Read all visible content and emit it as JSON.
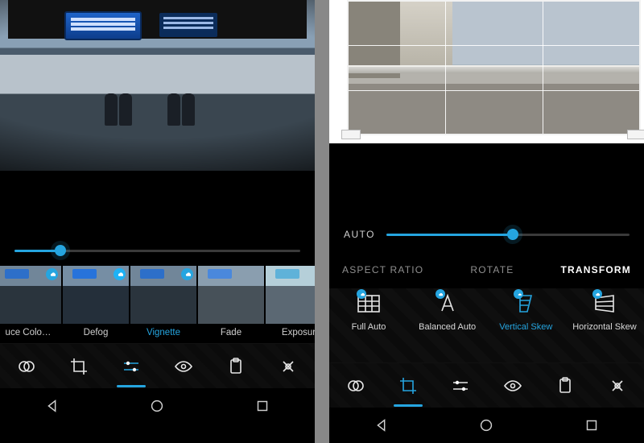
{
  "accent": "#25a5e0",
  "left": {
    "slider": {
      "value": 16,
      "min": 0,
      "max": 100
    },
    "filters": [
      {
        "id": "reduce-color-noise",
        "label": "uce Colo…",
        "cloud": true
      },
      {
        "id": "defog",
        "label": "Defog",
        "cloud": true
      },
      {
        "id": "vignette",
        "label": "Vignette",
        "cloud": true,
        "selected": true
      },
      {
        "id": "fade",
        "label": "Fade"
      },
      {
        "id": "exposure",
        "label": "Exposur"
      }
    ],
    "toolbar": [
      {
        "id": "filters",
        "icon": "overlap-circles"
      },
      {
        "id": "crop",
        "icon": "crop"
      },
      {
        "id": "adjust",
        "icon": "sliders",
        "active": true
      },
      {
        "id": "redeye",
        "icon": "eye"
      },
      {
        "id": "clipboard",
        "icon": "clipboard"
      },
      {
        "id": "heal",
        "icon": "sparkle"
      }
    ],
    "nav": [
      {
        "id": "back",
        "icon": "triangle-left"
      },
      {
        "id": "home",
        "icon": "circle"
      },
      {
        "id": "recent",
        "icon": "square"
      }
    ]
  },
  "right": {
    "autoLabel": "AUTO",
    "autoSlider": {
      "value": 52,
      "min": 0,
      "max": 100
    },
    "tabs": [
      {
        "id": "aspect-ratio",
        "label": "ASPECT RATIO"
      },
      {
        "id": "rotate",
        "label": "ROTATE"
      },
      {
        "id": "transform",
        "label": "TRANSFORM",
        "active": true
      }
    ],
    "presets": [
      {
        "id": "full-auto",
        "label": "Full Auto",
        "icon": "grid",
        "cloud": true
      },
      {
        "id": "balanced-auto",
        "label": "Balanced Auto",
        "icon": "text-skew",
        "cloud": true
      },
      {
        "id": "vertical-skew",
        "label": "Vertical Skew",
        "icon": "trapezoid-v",
        "cloud": true,
        "active": true
      },
      {
        "id": "horizontal-skew",
        "label": "Horizontal Skew",
        "icon": "trapezoid-h",
        "cloud": true
      }
    ],
    "toolbar": [
      {
        "id": "filters",
        "icon": "overlap-circles"
      },
      {
        "id": "crop",
        "icon": "crop",
        "active": true
      },
      {
        "id": "adjust",
        "icon": "sliders"
      },
      {
        "id": "redeye",
        "icon": "eye"
      },
      {
        "id": "clipboard",
        "icon": "clipboard"
      },
      {
        "id": "heal",
        "icon": "sparkle"
      }
    ],
    "nav": [
      {
        "id": "back",
        "icon": "triangle-left"
      },
      {
        "id": "home",
        "icon": "circle"
      },
      {
        "id": "recent",
        "icon": "square"
      }
    ]
  }
}
